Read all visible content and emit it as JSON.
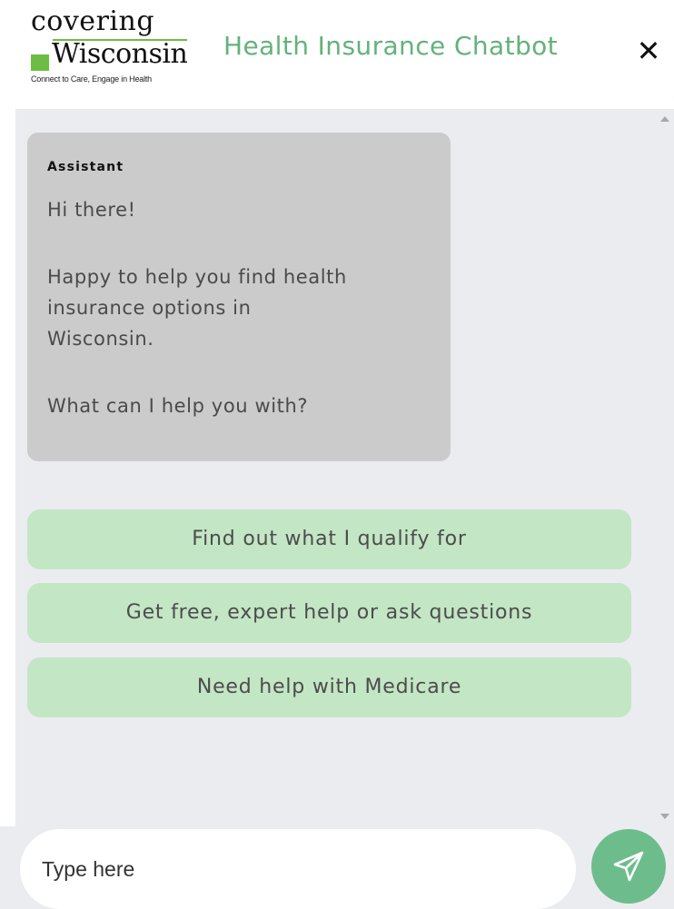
{
  "header": {
    "logo": {
      "line1": "covering",
      "line2": "Wisconsin",
      "tagline": "Connect to Care, Engage in Health"
    },
    "title": "Health Insurance Chatbot",
    "close_label": "✕"
  },
  "message": {
    "sender": "Assistant",
    "greeting": "Hi there!",
    "body_lines": [
      "Happy to help you find health",
      "insurance options in",
      "Wisconsin."
    ],
    "question": "What can I help you with?"
  },
  "options": [
    {
      "label": "Find out what I qualify for"
    },
    {
      "label": "Get free, expert help or ask questions"
    },
    {
      "label": "Need help with Medicare"
    }
  ],
  "composer": {
    "placeholder": "Type here",
    "send_icon": "paper-plane-icon"
  },
  "colors": {
    "title": "#64b27b",
    "option_bg": "#c3e6c5",
    "bubble_bg": "#cbcbcb",
    "send_bg": "#6dbd8c",
    "logo_green": "#6dbd45"
  }
}
